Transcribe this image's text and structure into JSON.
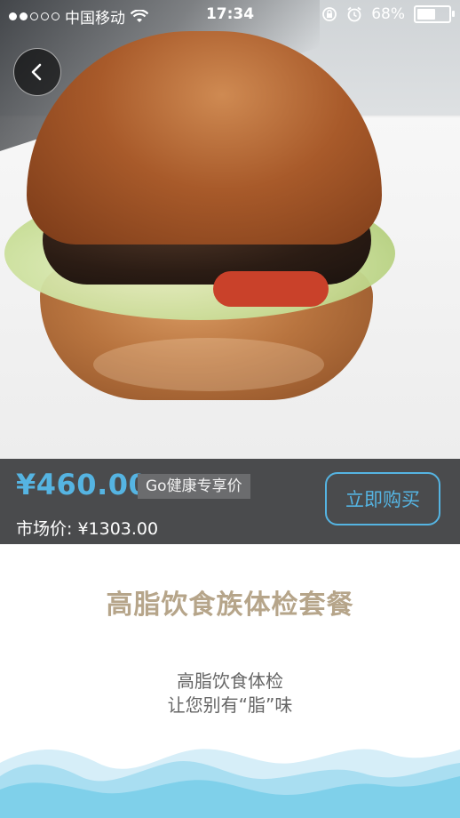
{
  "status_bar": {
    "carrier": "中国移动",
    "time": "17:34",
    "battery": "68%",
    "battery_level": 0.68,
    "signal_dots_filled": 2,
    "signal_dots_total": 5
  },
  "product": {
    "price": "¥460.00",
    "price_tag": "Go健康专享价",
    "market_price": "市场价: ¥1303.00",
    "buy_button": "立即购买"
  },
  "content": {
    "title": "高脂饮食族体检套餐",
    "subtitle_line1": "高脂饮食体检",
    "subtitle_line2": "让您别有“脂”味"
  },
  "colors": {
    "accent": "#55b4e2",
    "title_color": "#b6a58a",
    "price_bar_bg": "#4a4b4d",
    "wave_color": "#7fd0ea"
  },
  "icons": {
    "back": "chevron-left-icon",
    "wifi": "wifi-icon",
    "lock": "rotation-lock-icon",
    "alarm": "alarm-icon",
    "battery": "battery-icon"
  }
}
